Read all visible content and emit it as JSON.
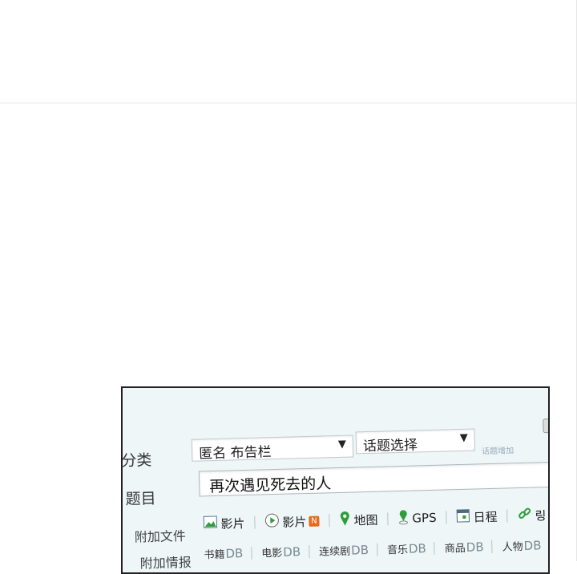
{
  "form": {
    "category_label": "分类",
    "category_select": "匿名 布告栏",
    "topic_select": "话题选择",
    "topic_add_link": "话题增加",
    "title_label": "题目",
    "title_value": "再次遇见死去的人",
    "attach_label": "附加文件",
    "attachments": [
      {
        "label": "影片",
        "icon": "image-icon"
      },
      {
        "label": "影片",
        "icon": "video-play-icon",
        "badge": "N"
      },
      {
        "label": "地图",
        "icon": "map-pin-icon"
      },
      {
        "label": "GPS",
        "icon": "gps-pin-icon"
      },
      {
        "label": "日程",
        "icon": "calendar-icon"
      },
      {
        "label": "링",
        "icon": "link-icon"
      }
    ],
    "info_label": "附加情报",
    "info_items": [
      {
        "label": "书籍",
        "db": "DB"
      },
      {
        "label": "电影",
        "db": "DB"
      },
      {
        "label": "连续剧",
        "db": "DB"
      },
      {
        "label": "音乐",
        "db": "DB"
      },
      {
        "label": "商品",
        "db": "DB"
      },
      {
        "label": "人物",
        "db": "DB"
      }
    ],
    "colors": {
      "panel_bg": "#eef6f8",
      "map_green": "#2e9e3a",
      "badge": "#e66a1a"
    }
  }
}
